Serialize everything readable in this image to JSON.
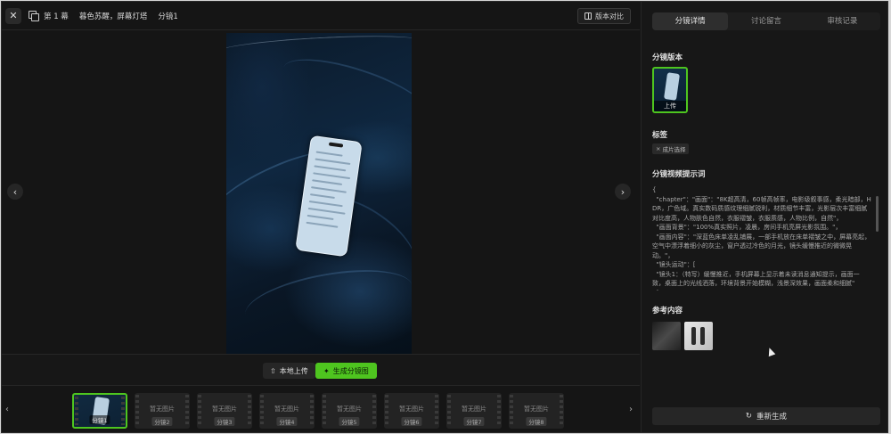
{
  "header": {
    "close_icon": "✕",
    "shot_label": "第 1 幕",
    "scene_title": "暮色苏醒，屏幕灯塔",
    "shot_index": "分镜1",
    "version_compare_label": "版本对比"
  },
  "preview": {
    "prev_arrow": "‹",
    "next_arrow": "›",
    "image_description_icon": "phone-on-bed-photo"
  },
  "actions": {
    "upload_icon": "⇧",
    "upload_label": "本地上传",
    "generate_icon": "✦",
    "generate_label": "生成分镜图"
  },
  "filmstrip": {
    "left_arrow": "‹",
    "right_arrow": "›",
    "items": [
      {
        "label": "",
        "tag": "分镜1",
        "active": true
      },
      {
        "label": "暂无图片",
        "tag": "分镜2"
      },
      {
        "label": "暂无图片",
        "tag": "分镜3"
      },
      {
        "label": "暂无图片",
        "tag": "分镜4"
      },
      {
        "label": "暂无图片",
        "tag": "分镜5"
      },
      {
        "label": "暂无图片",
        "tag": "分镜6"
      },
      {
        "label": "暂无图片",
        "tag": "分镜7"
      },
      {
        "label": "暂无图片",
        "tag": "分镜8"
      }
    ]
  },
  "panel": {
    "tabs": [
      {
        "label": "分镜详情",
        "active": true
      },
      {
        "label": "讨论留言"
      },
      {
        "label": "审核记录"
      }
    ],
    "version_title": "分镜版本",
    "version_tag": "上传",
    "tags_title": "标签",
    "tag_chip": "成片选择",
    "prompt_title": "分镜视频提示词",
    "prompt_text": "{\n  \"chapter\"：\"画面\"：\"8K超高清，60帧高帧率，电影级叙事感，柔光暗部，HDR，广色域。真实数码质感纹理细腻锐利，材质细节丰富，光影层次丰富细腻对比度高，人物肤色自然，衣服褶皱，衣服质感，人物比例，自然\"，\n  \"画面背景\"：\"100%真实照片，凌晨，房间手机亮屏光影氛围。\"，\n  \"画面内容\"：\"深蓝色床单凌乱铺展，一部手机放在床单褶皱之中，屏幕亮起，空气中漂浮着细小的灰尘，窗户透过冷色的月光，镜头缓慢推近的微微晃动。\"，\n  \"镜头运动\"：[\n  \"镜头1：（特写）缓慢推近，手机屏幕上显示着未读消息通知提示，画面一致，桌面上的光线洒落，环境背景开始模糊，浅景深效果，画面柔和细腻\"\n  ]\n}",
    "reference_title": "参考内容",
    "regen_icon": "↻",
    "regen_label": "重新生成"
  }
}
